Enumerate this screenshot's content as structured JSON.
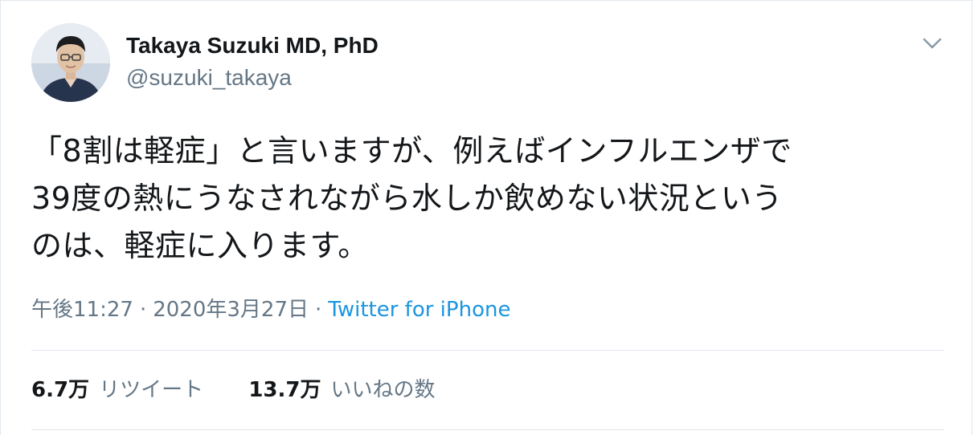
{
  "tweet": {
    "author": {
      "display_name": "Takaya Suzuki MD, PhD",
      "handle": "@suzuki_takaya"
    },
    "text_lines": [
      "「8割は軽症」と言いますが、例えばインフルエンザで",
      "39度の熱にうなされながら水しか飲めない状況という",
      "のは、軽症に入ります。"
    ],
    "time": "午後11:27",
    "date": "2020年3月27日",
    "separator": "·",
    "source": "Twitter for iPhone",
    "stats": {
      "retweets": {
        "count": "6.7万",
        "label": "リツイート"
      },
      "likes": {
        "count": "13.7万",
        "label": "いいねの数"
      }
    }
  },
  "colors": {
    "primary_text": "#14171a",
    "secondary_text": "#657786",
    "link": "#1b95e0",
    "border": "#e1e8ed"
  },
  "icons": {
    "caret": "chevron-down-icon",
    "avatar": "avatar-photo"
  }
}
